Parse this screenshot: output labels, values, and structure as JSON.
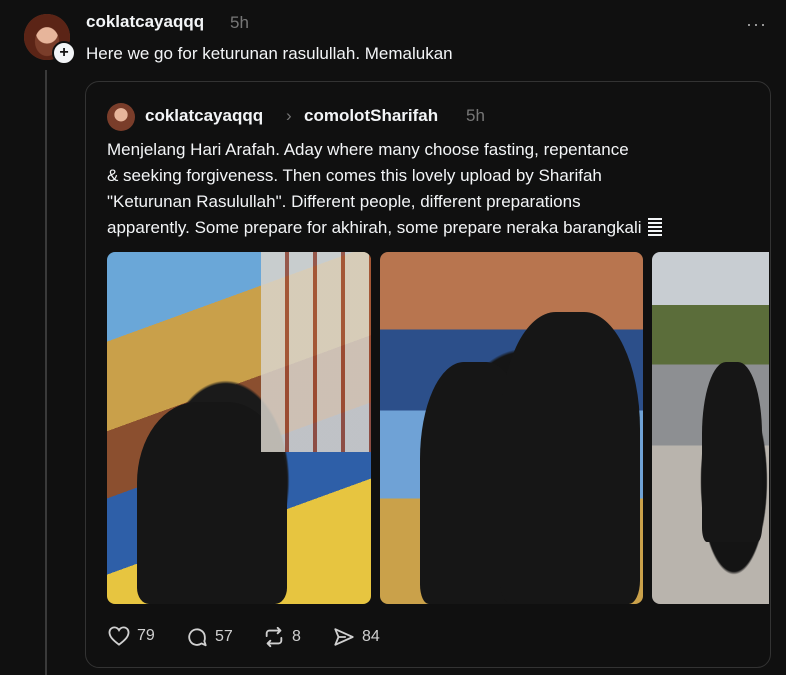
{
  "post": {
    "username": "coklatcayaqqq",
    "time": "5h",
    "text": "Here we go for keturunan rasulullah. Memalukan",
    "more": "···"
  },
  "quote": {
    "username": "coklatcayaqqq",
    "separator": "›",
    "reply_to": "comolotSharifah",
    "time": "5h",
    "text": "Menjelang Hari Arafah. Aday where many choose fasting, repentance\n& seeking forgiveness. Then comes this lovely upload by Sharifah\n\"Keturunan Rasulullah\". Different people, different preparations\napparently. Some prepare for akhirah, some prepare neraka barangkali",
    "photos": [
      "graffiti-kiss-photo",
      "couple-graffiti-photo",
      "street-walk-photo"
    ]
  },
  "actions": {
    "likes": "79",
    "replies": "57",
    "reposts": "8",
    "shares": "84"
  },
  "icons": {
    "like": "heart-icon",
    "reply": "comment-icon",
    "repost": "repost-icon",
    "share": "send-icon",
    "follow": "plus-icon"
  },
  "colors": {
    "background": "#101010",
    "text": "#f3f5f7",
    "muted": "#777777",
    "border": "#333333"
  }
}
